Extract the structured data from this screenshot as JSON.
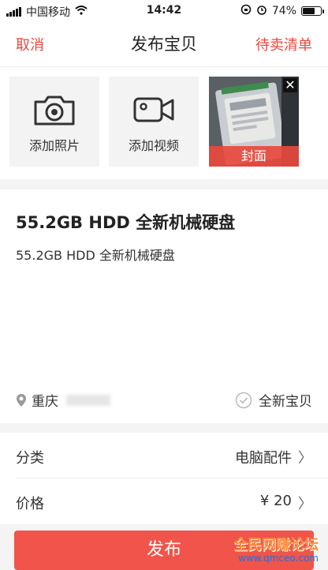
{
  "status": {
    "carrier": "中国移动",
    "time": "14:42",
    "battery": "74%",
    "battery_level": 0.74
  },
  "nav": {
    "cancel": "取消",
    "title": "发布宝贝",
    "list": "待卖清单"
  },
  "media": {
    "add_photo": "添加照片",
    "add_video": "添加视频",
    "cover_label": "封面",
    "close": "✕"
  },
  "item": {
    "title": "55.2GB HDD 全新机械硬盘",
    "description": "55.2GB HDD 全新机械硬盘",
    "location": "重庆",
    "condition": "全新宝贝"
  },
  "fields": [
    {
      "label": "分类",
      "value": "电脑配件"
    },
    {
      "label": "价格",
      "value": "¥ 20"
    }
  ],
  "chevron": "〉",
  "publish": "发布",
  "watermark": {
    "line1": "全民网赚论坛",
    "line2": "www.qmceo.com"
  },
  "colors": {
    "accent": "#e8493d",
    "button": "#f0544a"
  }
}
